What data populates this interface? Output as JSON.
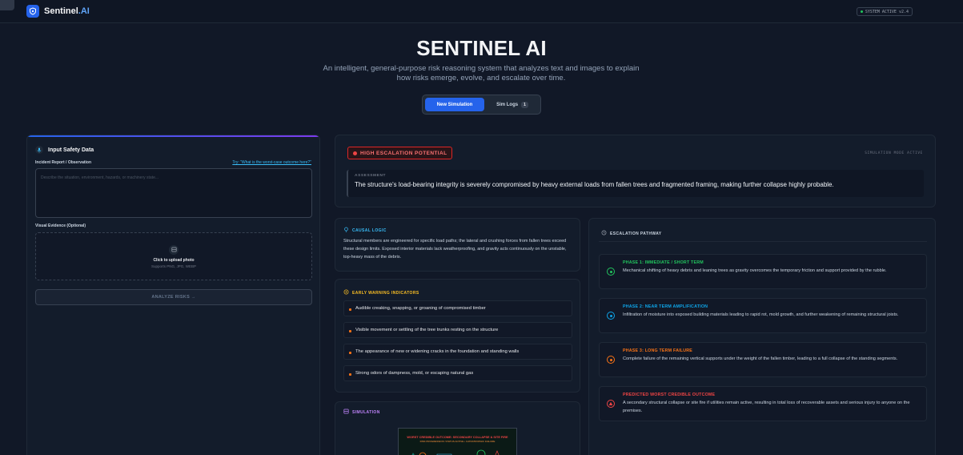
{
  "brand": {
    "name": "Sentinel",
    "suffix": ".AI"
  },
  "system_badge": "SYSTEM ACTIVE v2.4",
  "hero": {
    "title": "SENTINEL AI",
    "subtitle": "An intelligent, general-purpose risk reasoning system that analyzes text and images to explain how risks emerge, evolve, and escalate over time."
  },
  "mode_switch": {
    "new_simulation": "New Simulation",
    "sim_logs": "Sim Logs",
    "sim_logs_count": "1"
  },
  "input_panel": {
    "title": "Input Safety Data",
    "report_label": "Incident Report / Observation",
    "try_link": "Try: \"What is the worst-case outcome here?\"",
    "report_placeholder": "Describe the situation, environment, hazards, or machinery state...",
    "evidence_label": "Visual Evidence (Optional)",
    "upload_main": "Click to upload photo",
    "upload_sub": "Supports PNG, JPG, WEBP",
    "analyze_button": "ANALYZE RISKS →"
  },
  "assessment": {
    "badge": "HIGH ESCALATION POTENTIAL",
    "mode": "SIMULATION MODE ACTIVE",
    "label": "ASSESSMENT",
    "text": "The structure's load-bearing integrity is severely compromised by heavy external loads from fallen trees and fragmented framing, making further collapse highly probable."
  },
  "causal_logic": {
    "title": "CAUSAL LOGIC",
    "text": "Structural members are engineered for specific load paths; the lateral and crushing forces from fallen trees exceed these design limits. Exposed interior materials lack weatherproofing, and gravity acts continuously on the unstable, top-heavy mass of the debris."
  },
  "warnings": {
    "title": "EARLY WARNING INDICATORS",
    "items": [
      "Audible creaking, snapping, or groaning of compromised timber",
      "Visible movement or settling of the tree trunks resting on the structure",
      "The appearance of new or widening cracks in the foundation and standing walls",
      "Strong odors of dampness, mold, or escaping natural gas"
    ]
  },
  "simulation": {
    "title": "SIMULATION",
    "image_caption": "WORST CREDIBLE OUTCOME: SECONDARY COLLAPSE & SITE FIRE",
    "image_subcaption": "RISK PROGRESSION: STATUS ACTIVE • CATASTROPHIC FAILURE"
  },
  "pathway": {
    "title": "ESCALATION PATHWAY",
    "phases": [
      {
        "title": "PHASE 1: IMMEDIATE / SHORT TERM",
        "text": "Mechanical shifting of heavy debris and leaning trees as gravity overcomes the temporary friction and support provided by the rubble.",
        "color": "#22c55e"
      },
      {
        "title": "PHASE 2: NEAR TERM AMPLIFICATION",
        "text": "Infiltration of moisture into exposed building materials leading to rapid rot, mold growth, and further weakening of remaining structural joists.",
        "color": "#0ea5e9"
      },
      {
        "title": "PHASE 3: LONG TERM FAILURE",
        "text": "Complete failure of the remaining vertical supports under the weight of the fallen timber, leading to a full collapse of the standing segments.",
        "color": "#f97316"
      },
      {
        "title": "PREDICTED WORST CREDIBLE OUTCOME",
        "text": "A secondary structural collapse or site fire if utilities remain active, resulting in total loss of recoverable assets and serious injury to anyone on the premises.",
        "color": "#ef4444"
      }
    ]
  }
}
